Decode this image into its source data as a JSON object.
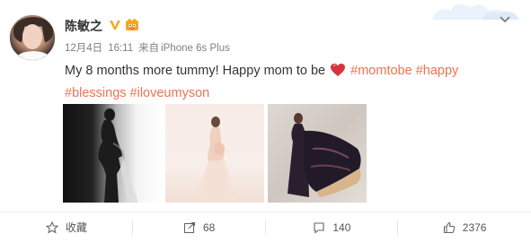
{
  "post": {
    "author": "陈敏之",
    "meta": {
      "date": "12月4日",
      "time": "16:11",
      "source_prefix": "来自",
      "source": "iPhone 6s Plus"
    },
    "text_before_heart": "My 8 months more tummy! Happy mom to be",
    "hashtags": [
      "#momtobe",
      "#happy",
      "#blessings",
      "#iloveumyson"
    ]
  },
  "actions": {
    "favorite_label": "收藏",
    "repost_count": "68",
    "comment_count": "140",
    "like_count": "2376"
  },
  "colors": {
    "hashtag": "#eb7350",
    "badge_gold": "#f6a623",
    "heart": "#d8333e"
  },
  "icons": [
    "chevron-down-icon",
    "verified-v-icon",
    "vip-badge-icon",
    "heart-emoji-icon",
    "star-icon",
    "repost-icon",
    "comment-icon",
    "thumbs-up-icon"
  ]
}
